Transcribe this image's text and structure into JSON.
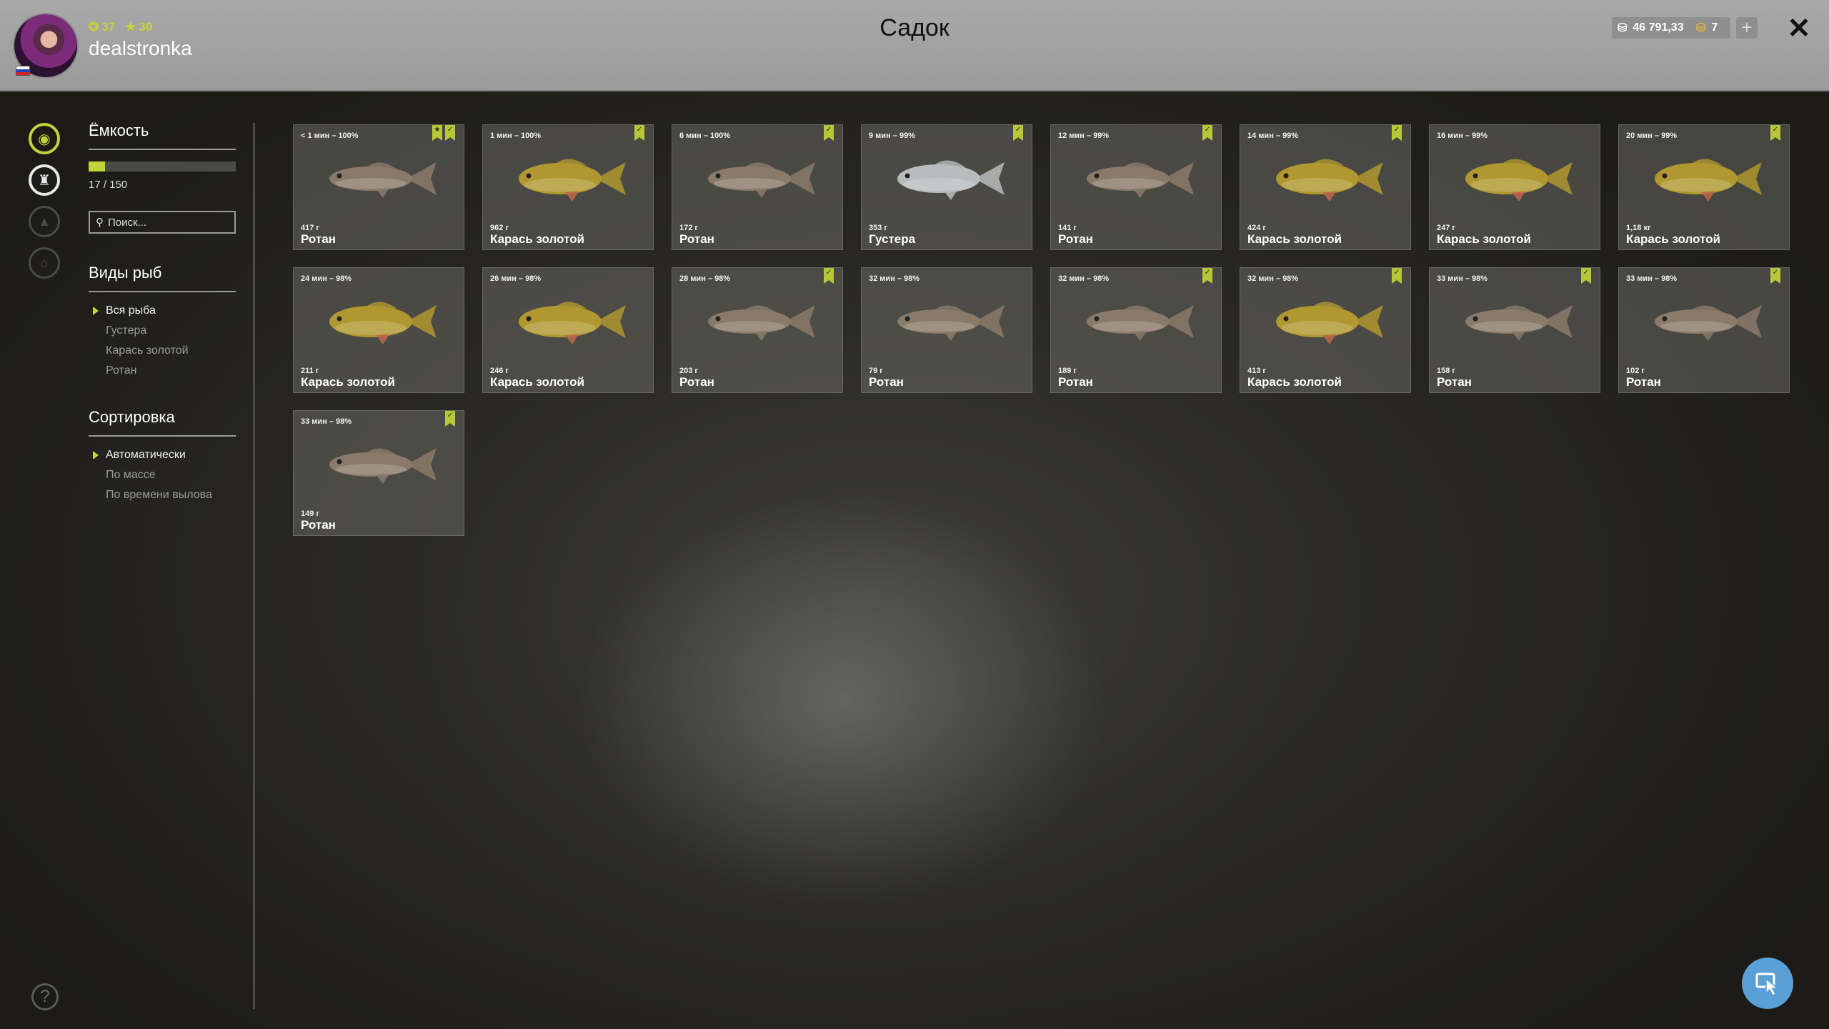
{
  "header": {
    "title": "Садок",
    "username": "dealstronka",
    "level": "37",
    "stars": "30",
    "silver": "46 791,33",
    "gold": "7",
    "add": "+",
    "close": "✕"
  },
  "sidebar_icons": [
    "fish-tank-icon",
    "trophy-icon",
    "boat-icon",
    "house-icon",
    "help-icon"
  ],
  "help_label": "?",
  "filters": {
    "capacity_title": "Ёмкость",
    "capacity_text": "17 / 150",
    "capacity_fraction": 0.113,
    "search_placeholder": "Поиск...",
    "species_title": "Виды рыб",
    "species": [
      "Вся рыба",
      "Густера",
      "Карась золотой",
      "Ротан"
    ],
    "species_selected": 0,
    "sort_title": "Сортировка",
    "sort": [
      "Автоматически",
      "По массе",
      "По времени вылова"
    ],
    "sort_selected": 0
  },
  "colors": {
    "accent": "#c4d33a",
    "rotan": "#8a7a6a",
    "karas": "#b0972f",
    "gustera": "#b9bcbc"
  },
  "fish_cards": [
    {
      "time": "< 1 мин – 100%",
      "weight": "417 г",
      "name": "Ротан",
      "type": "rotan",
      "badges": 2
    },
    {
      "time": "1 мин – 100%",
      "weight": "962 г",
      "name": "Карась золотой",
      "type": "karas",
      "badges": 1
    },
    {
      "time": "6 мин – 100%",
      "weight": "172 г",
      "name": "Ротан",
      "type": "rotan",
      "badges": 1
    },
    {
      "time": "9 мин – 99%",
      "weight": "353 г",
      "name": "Густера",
      "type": "gustera",
      "badges": 1
    },
    {
      "time": "12 мин – 99%",
      "weight": "141 г",
      "name": "Ротан",
      "type": "rotan",
      "badges": 1
    },
    {
      "time": "14 мин – 99%",
      "weight": "424 г",
      "name": "Карась золотой",
      "type": "karas",
      "badges": 1
    },
    {
      "time": "16 мин – 99%",
      "weight": "247 г",
      "name": "Карась золотой",
      "type": "karas",
      "badges": 0
    },
    {
      "time": "20 мин – 99%",
      "weight": "1,18 кг",
      "name": "Карась золотой",
      "type": "karas",
      "badges": 1
    },
    {
      "time": "24 мин – 98%",
      "weight": "211 г",
      "name": "Карась золотой",
      "type": "karas",
      "badges": 0
    },
    {
      "time": "26 мин – 98%",
      "weight": "246 г",
      "name": "Карась золотой",
      "type": "karas",
      "badges": 0
    },
    {
      "time": "28 мин – 98%",
      "weight": "203 г",
      "name": "Ротан",
      "type": "rotan",
      "badges": 1
    },
    {
      "time": "32 мин – 98%",
      "weight": "79 г",
      "name": "Ротан",
      "type": "rotan",
      "badges": 0
    },
    {
      "time": "32 мин – 98%",
      "weight": "189 г",
      "name": "Ротан",
      "type": "rotan",
      "badges": 1
    },
    {
      "time": "32 мин – 98%",
      "weight": "413 г",
      "name": "Карась золотой",
      "type": "karas",
      "badges": 1
    },
    {
      "time": "33 мин – 98%",
      "weight": "158 г",
      "name": "Ротан",
      "type": "rotan",
      "badges": 1
    },
    {
      "time": "33 мин – 98%",
      "weight": "102 г",
      "name": "Ротан",
      "type": "rotan",
      "badges": 1
    },
    {
      "time": "33 мин – 98%",
      "weight": "149 г",
      "name": "Ротан",
      "type": "rotan",
      "badges": 1
    }
  ]
}
